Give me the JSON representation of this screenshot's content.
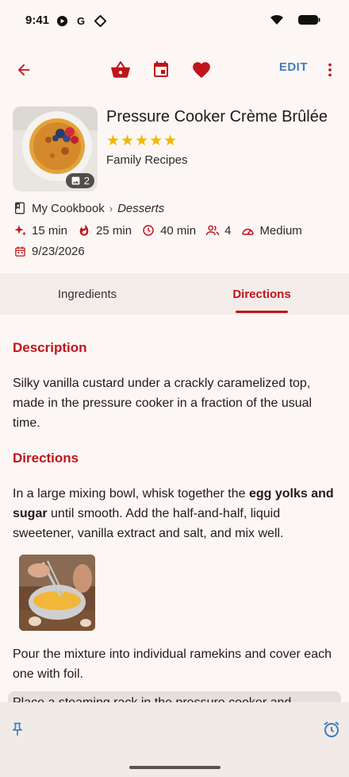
{
  "status": {
    "time": "9:41"
  },
  "toolbar": {
    "edit_label": "EDIT"
  },
  "recipe": {
    "title": "Pressure Cooker Crème Brûlée",
    "rating": "★★★★★",
    "category": "Family Recipes",
    "photo_count": "2",
    "cookbook": "My Cookbook",
    "subcategory": "Desserts",
    "prep_time": "15 min",
    "cook_time": "25 min",
    "total_time": "40 min",
    "servings": "4",
    "difficulty": "Medium",
    "date": "9/23/2026"
  },
  "tabs": {
    "ingredients": "Ingredients",
    "directions": "Directions"
  },
  "content": {
    "description_heading": "Description",
    "description_text": "Silky vanilla custard under a crackly caramelized top, made in the pressure cooker in a fraction of the usual time.",
    "directions_heading": "Directions",
    "step1_before": "In a large mixing bowl, whisk together the ",
    "step1_bold": "egg yolks and sugar",
    "step1_after": " until smooth. Add the half-and-half, liquid sweetener, vanilla extract and salt, and mix well.",
    "step2_text": "Pour the mixture into individual ramekins and cover each one with foil.",
    "step3_text": "Place a steaming rack in the pressure cooker and"
  },
  "colors": {
    "accent": "#c0141c",
    "edit": "#3d7fc1",
    "star": "#f2b600"
  }
}
